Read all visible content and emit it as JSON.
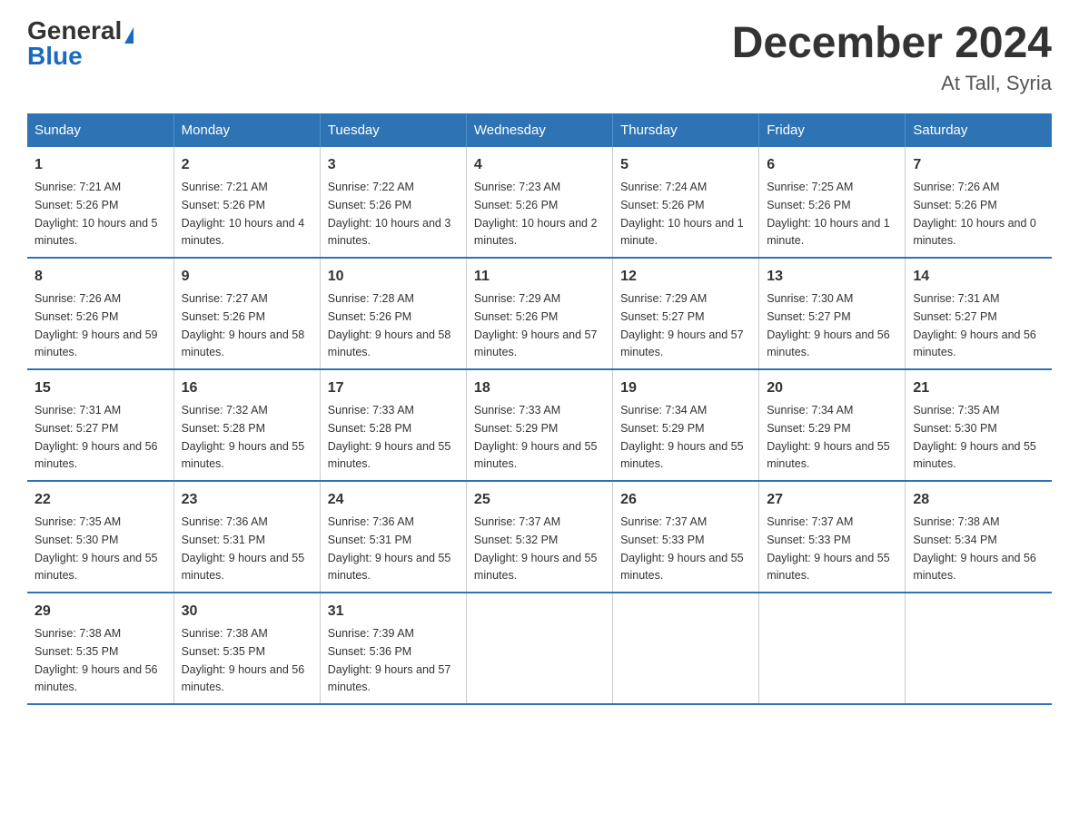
{
  "logo": {
    "general": "General",
    "blue": "Blue"
  },
  "title": "December 2024",
  "location": "At Tall, Syria",
  "days_of_week": [
    "Sunday",
    "Monday",
    "Tuesday",
    "Wednesday",
    "Thursday",
    "Friday",
    "Saturday"
  ],
  "weeks": [
    [
      {
        "day": "1",
        "sunrise": "7:21 AM",
        "sunset": "5:26 PM",
        "daylight": "10 hours and 5 minutes."
      },
      {
        "day": "2",
        "sunrise": "7:21 AM",
        "sunset": "5:26 PM",
        "daylight": "10 hours and 4 minutes."
      },
      {
        "day": "3",
        "sunrise": "7:22 AM",
        "sunset": "5:26 PM",
        "daylight": "10 hours and 3 minutes."
      },
      {
        "day": "4",
        "sunrise": "7:23 AM",
        "sunset": "5:26 PM",
        "daylight": "10 hours and 2 minutes."
      },
      {
        "day": "5",
        "sunrise": "7:24 AM",
        "sunset": "5:26 PM",
        "daylight": "10 hours and 1 minute."
      },
      {
        "day": "6",
        "sunrise": "7:25 AM",
        "sunset": "5:26 PM",
        "daylight": "10 hours and 1 minute."
      },
      {
        "day": "7",
        "sunrise": "7:26 AM",
        "sunset": "5:26 PM",
        "daylight": "10 hours and 0 minutes."
      }
    ],
    [
      {
        "day": "8",
        "sunrise": "7:26 AM",
        "sunset": "5:26 PM",
        "daylight": "9 hours and 59 minutes."
      },
      {
        "day": "9",
        "sunrise": "7:27 AM",
        "sunset": "5:26 PM",
        "daylight": "9 hours and 58 minutes."
      },
      {
        "day": "10",
        "sunrise": "7:28 AM",
        "sunset": "5:26 PM",
        "daylight": "9 hours and 58 minutes."
      },
      {
        "day": "11",
        "sunrise": "7:29 AM",
        "sunset": "5:26 PM",
        "daylight": "9 hours and 57 minutes."
      },
      {
        "day": "12",
        "sunrise": "7:29 AM",
        "sunset": "5:27 PM",
        "daylight": "9 hours and 57 minutes."
      },
      {
        "day": "13",
        "sunrise": "7:30 AM",
        "sunset": "5:27 PM",
        "daylight": "9 hours and 56 minutes."
      },
      {
        "day": "14",
        "sunrise": "7:31 AM",
        "sunset": "5:27 PM",
        "daylight": "9 hours and 56 minutes."
      }
    ],
    [
      {
        "day": "15",
        "sunrise": "7:31 AM",
        "sunset": "5:27 PM",
        "daylight": "9 hours and 56 minutes."
      },
      {
        "day": "16",
        "sunrise": "7:32 AM",
        "sunset": "5:28 PM",
        "daylight": "9 hours and 55 minutes."
      },
      {
        "day": "17",
        "sunrise": "7:33 AM",
        "sunset": "5:28 PM",
        "daylight": "9 hours and 55 minutes."
      },
      {
        "day": "18",
        "sunrise": "7:33 AM",
        "sunset": "5:29 PM",
        "daylight": "9 hours and 55 minutes."
      },
      {
        "day": "19",
        "sunrise": "7:34 AM",
        "sunset": "5:29 PM",
        "daylight": "9 hours and 55 minutes."
      },
      {
        "day": "20",
        "sunrise": "7:34 AM",
        "sunset": "5:29 PM",
        "daylight": "9 hours and 55 minutes."
      },
      {
        "day": "21",
        "sunrise": "7:35 AM",
        "sunset": "5:30 PM",
        "daylight": "9 hours and 55 minutes."
      }
    ],
    [
      {
        "day": "22",
        "sunrise": "7:35 AM",
        "sunset": "5:30 PM",
        "daylight": "9 hours and 55 minutes."
      },
      {
        "day": "23",
        "sunrise": "7:36 AM",
        "sunset": "5:31 PM",
        "daylight": "9 hours and 55 minutes."
      },
      {
        "day": "24",
        "sunrise": "7:36 AM",
        "sunset": "5:31 PM",
        "daylight": "9 hours and 55 minutes."
      },
      {
        "day": "25",
        "sunrise": "7:37 AM",
        "sunset": "5:32 PM",
        "daylight": "9 hours and 55 minutes."
      },
      {
        "day": "26",
        "sunrise": "7:37 AM",
        "sunset": "5:33 PM",
        "daylight": "9 hours and 55 minutes."
      },
      {
        "day": "27",
        "sunrise": "7:37 AM",
        "sunset": "5:33 PM",
        "daylight": "9 hours and 55 minutes."
      },
      {
        "day": "28",
        "sunrise": "7:38 AM",
        "sunset": "5:34 PM",
        "daylight": "9 hours and 56 minutes."
      }
    ],
    [
      {
        "day": "29",
        "sunrise": "7:38 AM",
        "sunset": "5:35 PM",
        "daylight": "9 hours and 56 minutes."
      },
      {
        "day": "30",
        "sunrise": "7:38 AM",
        "sunset": "5:35 PM",
        "daylight": "9 hours and 56 minutes."
      },
      {
        "day": "31",
        "sunrise": "7:39 AM",
        "sunset": "5:36 PM",
        "daylight": "9 hours and 57 minutes."
      },
      null,
      null,
      null,
      null
    ]
  ]
}
